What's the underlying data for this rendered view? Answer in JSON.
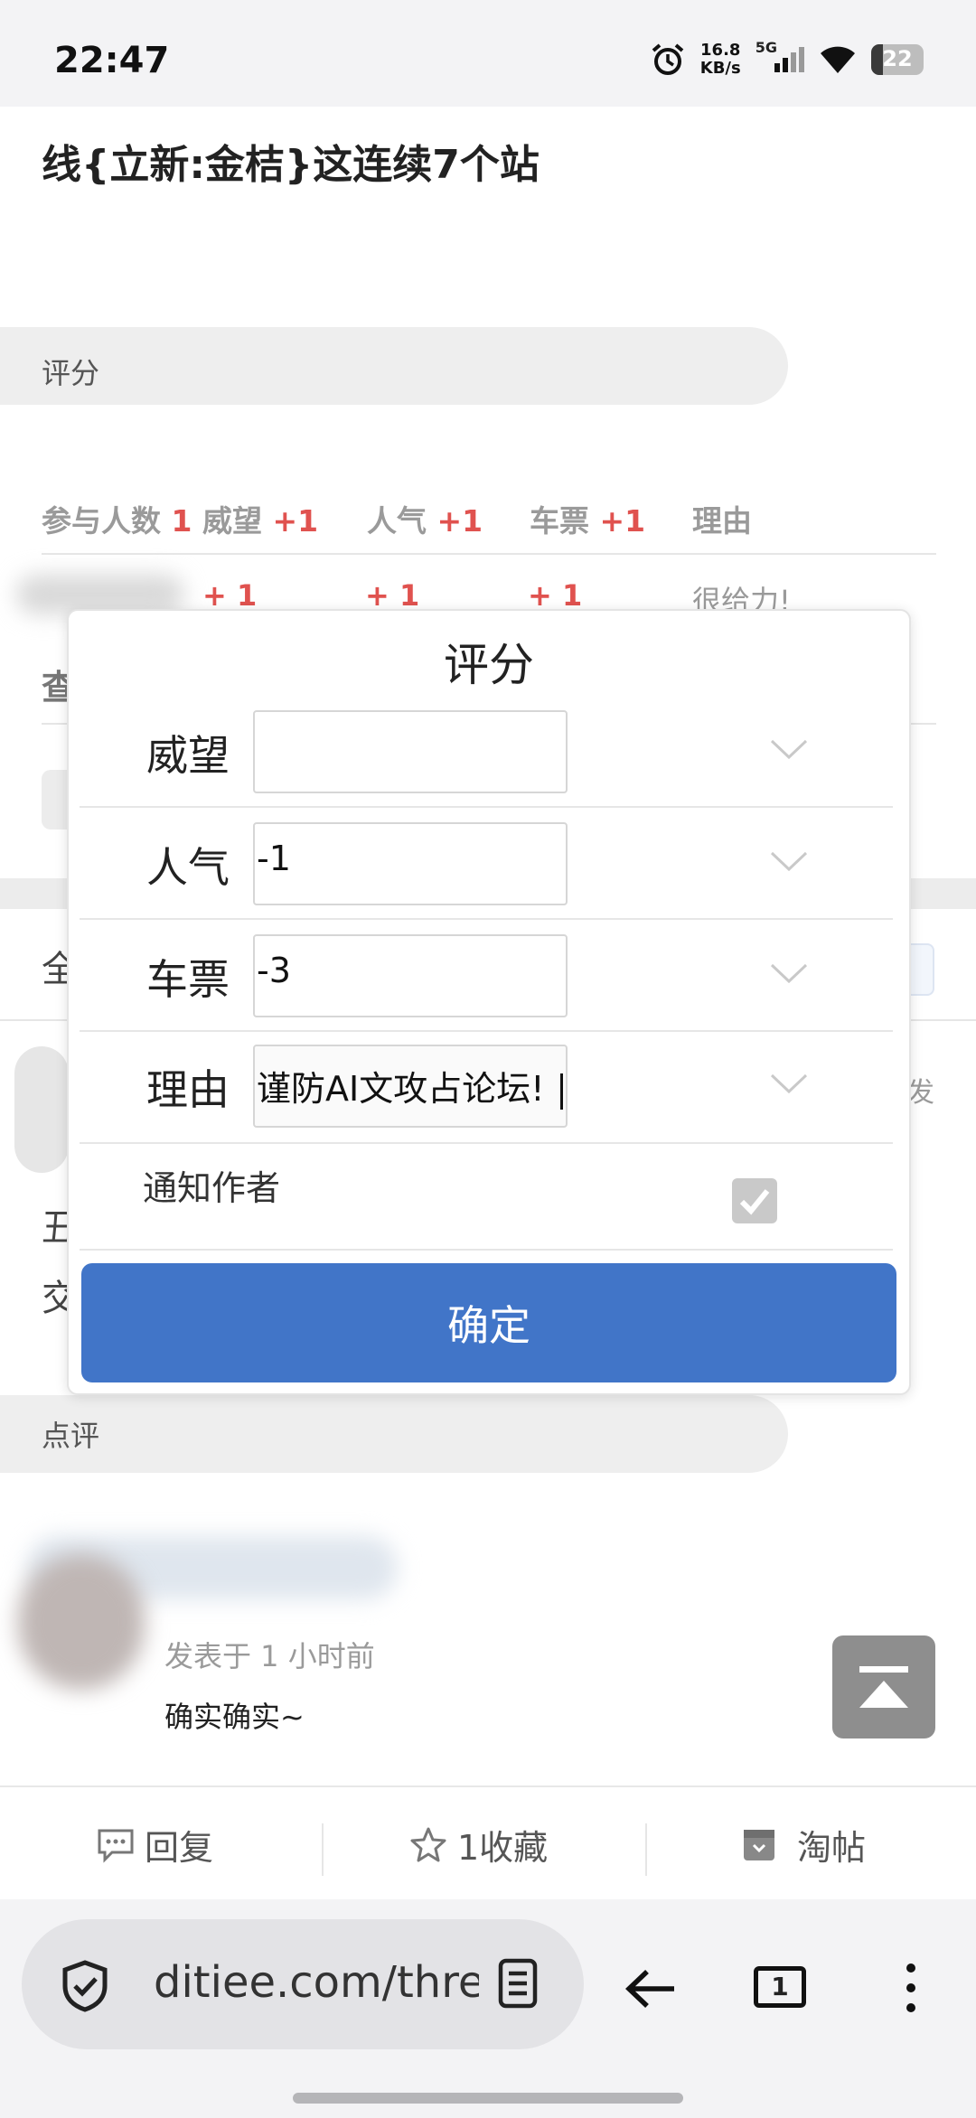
{
  "status_bar": {
    "time": "22:47",
    "speed_value": "16.8",
    "speed_unit": "KB/s",
    "network": "5G",
    "battery": "22"
  },
  "thread": {
    "title": "线{立新:金桔}这连续7个站"
  },
  "rating_section": {
    "label": "评分",
    "header": {
      "participants_label": "参与人数",
      "participants_count": "1",
      "prestige_label": "威望",
      "prestige_delta": "+1",
      "popularity_label": "人气",
      "popularity_delta": "+1",
      "ticket_label": "车票",
      "ticket_delta": "+1",
      "reason_label": "理由"
    },
    "row": {
      "prestige": "+ 1",
      "popularity": "+ 1",
      "ticket": "+ 1",
      "reason": "很给力!"
    },
    "view_all_char": "查"
  },
  "behind_chars": {
    "a": "全",
    "b": "丑",
    "c": "交",
    "right": "发"
  },
  "review_section": {
    "label": "点评"
  },
  "comment": {
    "meta": "发表于 1 小时前",
    "text": "确实确实~"
  },
  "action_bar": {
    "reply": "回复",
    "favorite": "1收藏",
    "tao": "淘帖"
  },
  "browser": {
    "url": "ditiee.com/thre",
    "tab_count": "1"
  },
  "modal": {
    "title": "评分",
    "fields": [
      {
        "label": "威望",
        "value": ""
      },
      {
        "label": "人气",
        "value": "-1"
      },
      {
        "label": "车票",
        "value": "-3"
      },
      {
        "label": "理由",
        "value": "谨防AI文攻占论坛!"
      }
    ],
    "notify_label": "通知作者",
    "notify_checked": true,
    "confirm_label": "确定"
  },
  "colors": {
    "accent": "#4175c8",
    "delta_red": "#e0524f"
  }
}
